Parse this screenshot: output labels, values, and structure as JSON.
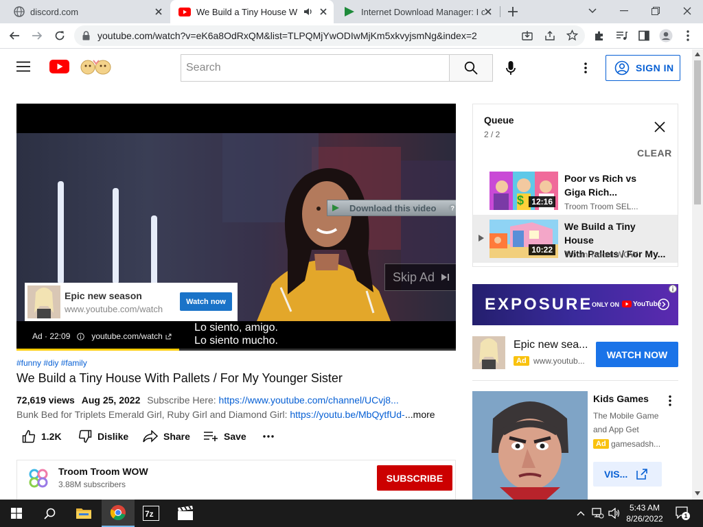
{
  "browser": {
    "tabs": [
      {
        "title": "discord.com",
        "active": false
      },
      {
        "title": "We Build a Tiny House With",
        "active": true
      },
      {
        "title": "Internet Download Manager: I ca",
        "active": false
      }
    ],
    "url": "youtube.com/watch?v=eK6a8OdRxQM&list=TLPQMjYwODIwMjKm5xkvyjsmNg&index=2"
  },
  "youtube": {
    "search_placeholder": "Search",
    "signin_label": "SIGN IN"
  },
  "player": {
    "idm_label": "Download this video",
    "ad_overlay": {
      "title": "Epic new season",
      "url": "www.youtube.com/watch",
      "button": "Watch now"
    },
    "skip_label": "Skip Ad",
    "subtitles": [
      "Lo siento, amigo.",
      "Lo siento mucho."
    ],
    "ad_info": {
      "time": "Ad · 22:09",
      "url": "youtube.com/watch"
    },
    "progress": 0.37
  },
  "video": {
    "hashtags": "#funny #diy #family",
    "title": "We Build a Tiny House With Pallets / For My Younger Sister",
    "views": "72,619 views",
    "date": "Aug 25, 2022",
    "subscribe_here": "Subscribe Here:",
    "channel_link": "https://www.youtube.com/channel/UCvj8...",
    "desc_text": "Bunk Bed for Triplets Emerald Girl, Ruby Girl and Diamond Girl:",
    "desc_link": "https://youtu.be/MbQytfUd-",
    "more": "...more",
    "likes": "1.2K",
    "dislike": "Dislike",
    "share": "Share",
    "save": "Save"
  },
  "channel": {
    "name": "Troom Troom WOW",
    "subscribers": "3.88M subscribers",
    "subscribe_button": "SUBSCRIBE"
  },
  "queue": {
    "title": "Queue",
    "position": "2 / 2",
    "clear_label": "CLEAR",
    "items": [
      {
        "title_line1": "Poor vs Rich vs",
        "title_line2": "Giga Rich...",
        "duration": "12:16",
        "channel": "Troom Troom SEL..."
      },
      {
        "title_line1": "We Build a Tiny House",
        "title_line2": "With Pallets / For My...",
        "duration": "10:22",
        "channel": "Troom Troom WOW"
      }
    ]
  },
  "ads": {
    "banner_text": "EXPOSURE",
    "banner_sub": "ONLY ON",
    "banner_brand": "YouTube",
    "ad2": {
      "title": "Epic new sea...",
      "badge": "Ad",
      "url": "www.youtub...",
      "button": "WATCH NOW"
    },
    "ad3": {
      "title": "Kids Games",
      "desc_line1": "The Mobile Game",
      "desc_line2": "and App Get",
      "badge": "Ad",
      "url": "gamesadsh...",
      "button": "VIS..."
    }
  },
  "taskbar": {
    "time": "5:43 AM",
    "date": "8/26/2022",
    "notification_count": "1"
  },
  "colors": {
    "youtube_red": "#ff0000",
    "link_blue": "#065fd4",
    "subscribe_red": "#cc0000",
    "ad_yellow": "#f9c20f",
    "progress_yellow": "#ffcc00"
  }
}
